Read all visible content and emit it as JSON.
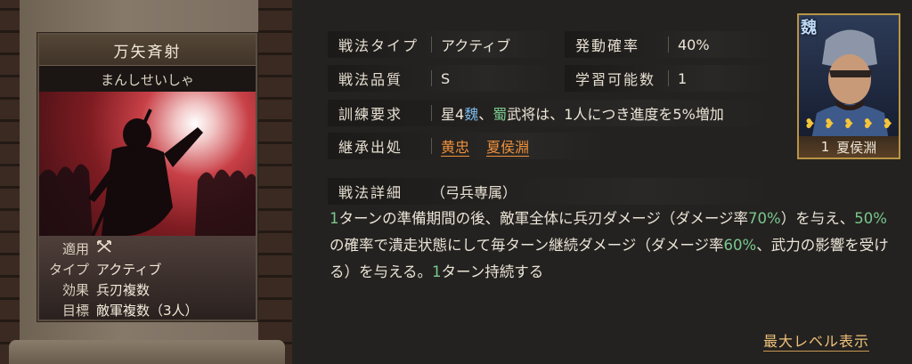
{
  "card": {
    "title": "万矢斉射",
    "reading": "まんしせいしゃ",
    "rows": [
      {
        "key": "適用",
        "value": ""
      },
      {
        "key": "タイプ",
        "value": "アクティブ"
      },
      {
        "key": "効果",
        "value": "兵刃複数"
      },
      {
        "key": "目標",
        "value": "敵軍複数（3人）"
      }
    ]
  },
  "fields": {
    "type_label": "戦法タイプ",
    "type_value": "アクティブ",
    "rate_label": "発動確率",
    "rate_value": "40%",
    "quality_label": "戦法品質",
    "quality_value": "S",
    "learn_label": "学習可能数",
    "learn_value": "1",
    "train_label": "訓練要求",
    "train_value_1": "星4",
    "train_value_wei": "魏",
    "train_value_2": "、",
    "train_value_shu": "蜀",
    "train_value_3": "武将は、1人につき進度を5%増加",
    "inherit_label": "継承出処",
    "inherit_sources": [
      "黄忠",
      "夏侯淵"
    ],
    "detail_label": "戦法詳細",
    "detail_tag": "（弓兵専属）"
  },
  "description": {
    "p1": "1",
    "p2": "ターンの準備期間の後、敵軍全体に兵刃ダメージ（ダメージ率",
    "p3": "70%",
    "p4": "）を与え、",
    "p5": "50%",
    "p6": "の確率で潰走状態にして毎ターン継続ダメージ（ダメージ率",
    "p7": "60%",
    "p8": "、武力の影響を受ける）を与える。",
    "p9": "1",
    "p10": "ターン持続する"
  },
  "portrait": {
    "faction": "魏",
    "stars": [
      "❥",
      "❥",
      "❥",
      "❥",
      "❥"
    ],
    "count": "1",
    "name": "夏侯淵"
  },
  "max_level_link": "最大レベル表示",
  "colors": {
    "accent_orange": "#f0913c",
    "highlight_green": "#79c88e",
    "highlight_blue": "#79b8e8",
    "gold": "#b99445"
  }
}
